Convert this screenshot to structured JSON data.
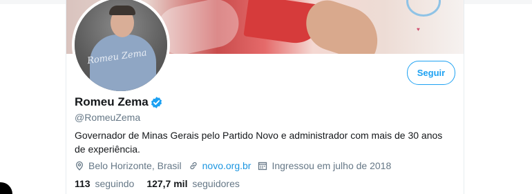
{
  "profile": {
    "display_name": "Romeu Zema",
    "handle": "@RomeuZema",
    "bio": "Governador de Minas Gerais pelo Partido Novo e administrador com mais de 30 anos de experiência.",
    "follow_label": "Seguir",
    "avatar_signature": "Romeu Zema"
  },
  "meta": {
    "location": "Belo Horizonte, Brasil",
    "website": "novo.org.br",
    "joined": "Ingressou em julho de 2018"
  },
  "stats": {
    "following_count": "113",
    "following_label": "seguindo",
    "followers_count": "127,7 mil",
    "followers_label": "seguidores"
  },
  "colors": {
    "accent": "#1da1f2",
    "link": "#1b95e0",
    "secondary_text": "#657786",
    "primary_text": "#14171a"
  },
  "icons": {
    "verified": "verified-badge-icon",
    "location": "location-pin-icon",
    "link": "link-icon",
    "calendar": "calendar-icon"
  }
}
